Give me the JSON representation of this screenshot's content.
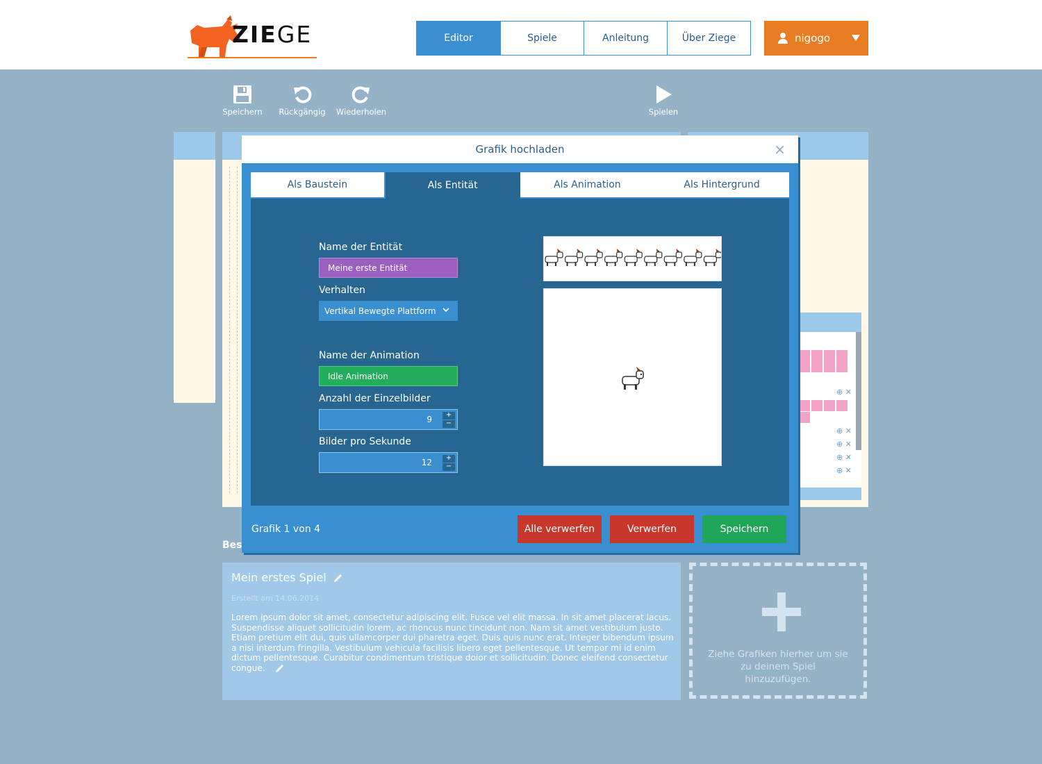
{
  "header": {
    "logo_text_bold": "ZIE",
    "logo_text_light": "GE",
    "nav": [
      {
        "label": "Editor",
        "active": true
      },
      {
        "label": "Spiele",
        "active": false
      },
      {
        "label": "Anleitung",
        "active": false
      },
      {
        "label": "Über Ziege",
        "active": false
      }
    ],
    "user": {
      "name": "nigogo"
    }
  },
  "toolbar": {
    "save": "Speichern",
    "undo": "Rückgängig",
    "redo": "Wiederholen",
    "play": "Spielen"
  },
  "game": {
    "section_label": "Besc",
    "title": "Mein erstes Spiel",
    "created": "Erstellt am 14.06.2014",
    "description": "Lorem ipsum dolor sit amet, consectetur adipiscing elit. Fusce vel elit massa. In sit amet placerat lacus. Suspendisse aliquet sollicitudin lorem, ac rhoncus nunc tincidunt non. Nam sit amet vestibulum justo. Etiam pretium elit dui, quis ullamcorper dui pharetra eget. Duis quis nunc erat. Integer bibendum ipsum a nisi interdum fringilla. Vestibulum vehicula facilisis libero eget pellentesque. Ut tempor mi id enim dictum pellentesque. Curabitur condimentum tristique dolor et sollicitudin. Donec eleifend consectetur congue."
  },
  "dropzone": {
    "text": "Ziehe Grafiken hierher um sie zu deinem Spiel hinzuzufügen."
  },
  "modal": {
    "title": "Grafik hochladen",
    "close": "×",
    "tabs": [
      {
        "label": "Als Baustein",
        "active": false
      },
      {
        "label": "Als Entität",
        "active": true
      },
      {
        "label": "Als Animation",
        "active": false
      },
      {
        "label": "Als Hintergrund",
        "active": false
      }
    ],
    "entity_name_label": "Name der Entität",
    "entity_name_value": "Meine erste Entität",
    "behavior_label": "Verhalten",
    "behavior_value": "Vertikal Bewegte Plattform",
    "animation_name_label": "Name der Animation",
    "animation_name_value": "Idle Animation",
    "frames_label": "Anzahl der Einzelbilder",
    "frames_value": "9",
    "fps_label": "Bilder pro Sekunde",
    "fps_value": "12",
    "counter": "Grafik 1 von 4",
    "discard_all": "Alle verwerfen",
    "discard": "Verwerfen",
    "save": "Speichern"
  },
  "colors": {
    "accent_blue": "#3a8fd0",
    "brand_orange": "#e77c22",
    "danger_red": "#c9362c",
    "success_green": "#1fa658",
    "entity_purple": "#9b5fc0"
  }
}
